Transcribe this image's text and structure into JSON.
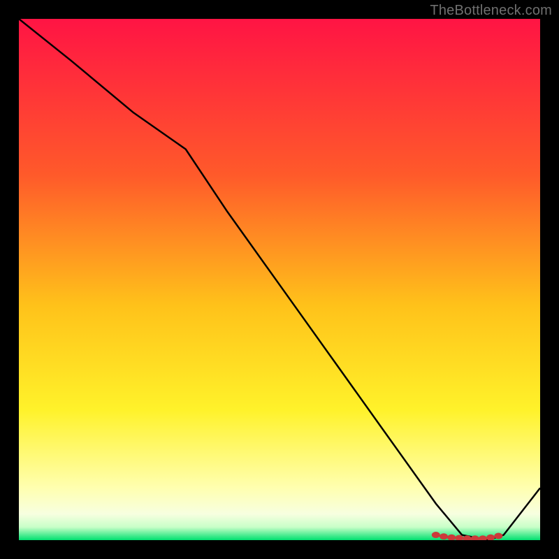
{
  "attribution": "TheBottleneck.com",
  "chart_data": {
    "type": "line",
    "title": "",
    "xlabel": "",
    "ylabel": "",
    "xlim": [
      0,
      100
    ],
    "ylim": [
      0,
      100
    ],
    "x": [
      0,
      10,
      22,
      32,
      40,
      50,
      60,
      70,
      80,
      85,
      90,
      93,
      100
    ],
    "values": [
      100,
      92,
      82,
      75,
      63,
      49,
      35,
      21,
      7,
      1,
      0,
      1,
      10
    ],
    "markers": {
      "x": [
        80.0,
        81.5,
        83.0,
        84.5,
        86.0,
        87.5,
        89.0,
        90.5,
        92.0
      ],
      "values": [
        1.0,
        0.7,
        0.5,
        0.4,
        0.3,
        0.3,
        0.3,
        0.5,
        0.8
      ]
    },
    "background_gradient_stops": [
      {
        "offset": 0.0,
        "color": "#ff1444"
      },
      {
        "offset": 0.3,
        "color": "#ff5a2a"
      },
      {
        "offset": 0.55,
        "color": "#ffc21a"
      },
      {
        "offset": 0.75,
        "color": "#fff22a"
      },
      {
        "offset": 0.9,
        "color": "#ffffb0"
      },
      {
        "offset": 0.95,
        "color": "#f7ffe0"
      },
      {
        "offset": 0.975,
        "color": "#c8ffc8"
      },
      {
        "offset": 1.0,
        "color": "#00e070"
      }
    ],
    "line_color": "#000000",
    "marker_color": "#cc3a3a"
  }
}
